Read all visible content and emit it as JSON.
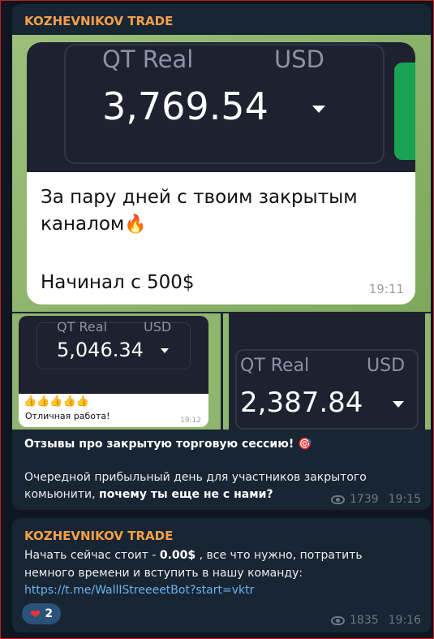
{
  "colors": {
    "background": "#0e1621",
    "bubble": "#182533",
    "channel_name": "#f4a04a",
    "link": "#6ab3f3",
    "reaction_bg": "#2b5278"
  },
  "post1": {
    "channel": "KOZHEVNIKOV TRADE",
    "photo1": {
      "account_label": "QT Real",
      "currency": "USD",
      "amount": "3,769.54",
      "text_line1": "За пару дней с твоим закрытым",
      "text_line2": "каналом",
      "text_line3": "Начинал с 500$",
      "emoji": "🔥",
      "time": "19:11"
    },
    "photo2": {
      "account_label": "QT Real",
      "currency": "USD",
      "amount": "5,046.34",
      "emojis": "👍👍👍👍👍",
      "text": "Отличная работа!",
      "time": "19:12"
    },
    "photo3": {
      "account_label": "QT Real",
      "currency": "USD",
      "amount": "2,387.84"
    },
    "caption_title": "Отзывы про закрытую торговую сессию!",
    "caption_emoji": "🎯",
    "caption_body_1": "Очередной прибыльный день для участников закрытого",
    "caption_body_2": "комьюнити, ",
    "caption_body_bold": "почему ты еще не с нами?",
    "views": "1739",
    "time": "19:15"
  },
  "post2": {
    "channel": "KOZHEVNIKOV TRADE",
    "text_1": "Начать сейчас стоит - ",
    "text_price": "0.00$",
    "text_2": " , все что нужно, потратить",
    "text_3": "немного времени и вступить в нашу команду:",
    "link": "https://t.me/WallIStreeeetBot?start=vktr",
    "reaction_emoji": "❤",
    "reaction_count": "2",
    "views": "1835",
    "time": "19:16"
  }
}
